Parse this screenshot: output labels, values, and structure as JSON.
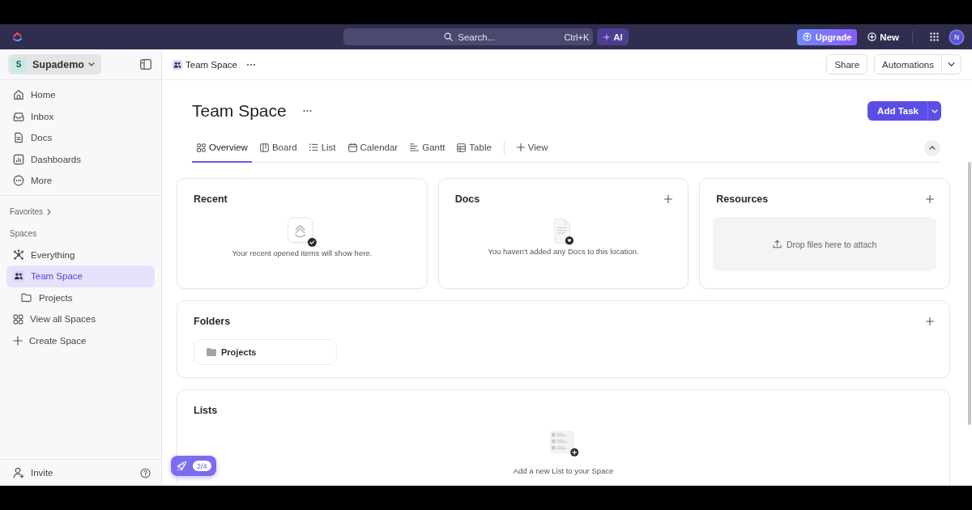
{
  "top_bar": {
    "search": {
      "placeholder": "Search...",
      "shortcut": "Ctrl+K"
    },
    "ai_button": "AI",
    "upgrade_button": "Upgrade",
    "new_button": "New",
    "avatar": "N"
  },
  "sidebar": {
    "workspace": {
      "initial": "S",
      "name": "Supademo"
    },
    "nav_items": [
      {
        "label": "Home"
      },
      {
        "label": "Inbox"
      },
      {
        "label": "Docs"
      },
      {
        "label": "Dashboards"
      },
      {
        "label": "More"
      }
    ],
    "favorites": "Favorites",
    "spaces_heading": "Spaces",
    "spaces": [
      {
        "label": "Everything",
        "selected": false
      },
      {
        "label": "Team Space",
        "selected": true,
        "children": [
          {
            "label": "Projects",
            "selected": false
          }
        ]
      }
    ],
    "space_actions": [
      {
        "label": "View all Spaces"
      },
      {
        "label": "Create Space"
      }
    ],
    "invite": "Invite"
  },
  "header": {
    "breadcrumb": "Team Space",
    "share_button": "Share",
    "automations_button": "Automations"
  },
  "page": {
    "title": "Team Space",
    "add_task_button": "Add Task",
    "tabs": [
      {
        "label": "Overview",
        "selected": true
      },
      {
        "label": "Board",
        "selected": false
      },
      {
        "label": "List",
        "selected": false
      },
      {
        "label": "Calendar",
        "selected": false
      },
      {
        "label": "Gantt",
        "selected": false
      },
      {
        "label": "Table",
        "selected": false
      }
    ],
    "add_view": "View"
  },
  "cards": {
    "recent": {
      "title": "Recent",
      "empty_text": "Your recent opened items will show here."
    },
    "docs": {
      "title": "Docs",
      "empty_text": "You haven't added any Docs to this location."
    },
    "resources": {
      "title": "Resources",
      "dropzone": "Drop files here to attach"
    }
  },
  "folders": {
    "title": "Folders",
    "items": [
      {
        "label": "Projects"
      }
    ]
  },
  "lists": {
    "title": "Lists",
    "empty_text": "Add a new List to your Space"
  },
  "onboarding": {
    "progress": "2/4"
  }
}
